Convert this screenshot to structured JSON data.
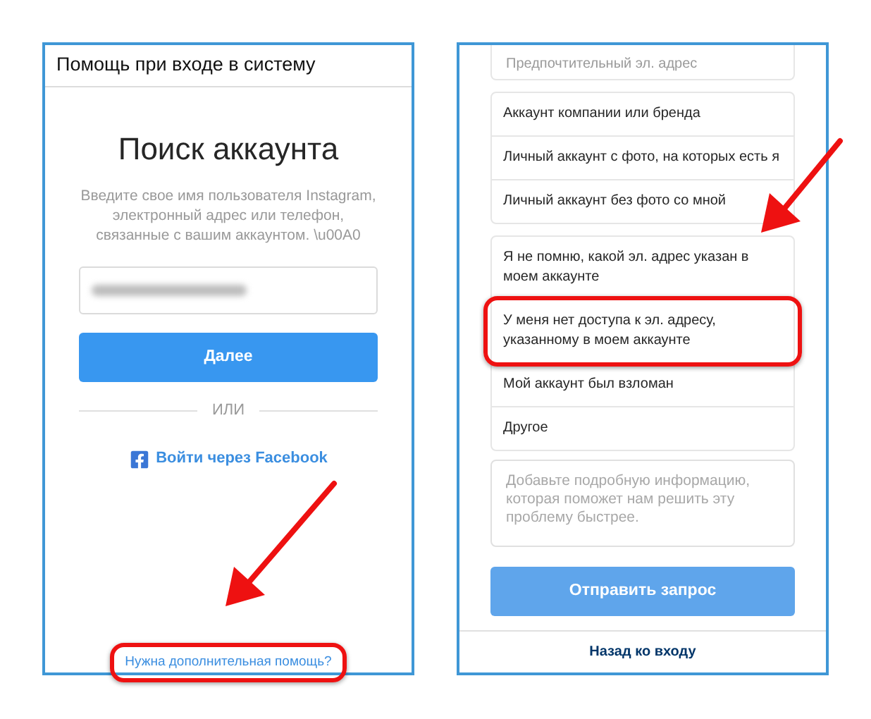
{
  "left_screen": {
    "header": "Помощь при входе в систему",
    "title": "Поиск аккаунта",
    "description": "Введите свое имя пользователя Instagram, электронный адрес или телефон, связанные с вашим аккаунтом. \\u00A0",
    "next_button": "Далее",
    "divider_label": "ИЛИ",
    "facebook_link": "Войти через Facebook",
    "help_link": {
      "label": "Нужна дополнительная помощь?",
      "highlighted": true
    }
  },
  "right_screen": {
    "top_option": "Предпочтительный эл. адрес",
    "account_types": [
      {
        "label": "Аккаунт компании или бренда",
        "highlighted": false
      },
      {
        "label": "Личный аккаунт с фото, на которых есть я",
        "highlighted": false
      },
      {
        "label": "Личный аккаунт без фото со мной",
        "highlighted": false
      }
    ],
    "problems": [
      {
        "label": "Я не помню, какой эл. адрес указан в моем аккаунте",
        "highlighted": false
      },
      {
        "label": "У меня нет доступа к эл. адресу, указанному в моем аккаунте",
        "highlighted": true
      },
      {
        "label": "Мой аккаунт был взломан",
        "highlighted": false
      },
      {
        "label": "Другое",
        "highlighted": false
      }
    ],
    "details_placeholder": "Добавьте подробную информацию, которая поможет нам решить эту проблему быстрее.",
    "submit_button": {
      "label": "Отправить запрос",
      "disabled": true
    },
    "back_link": "Назад ко входу"
  }
}
